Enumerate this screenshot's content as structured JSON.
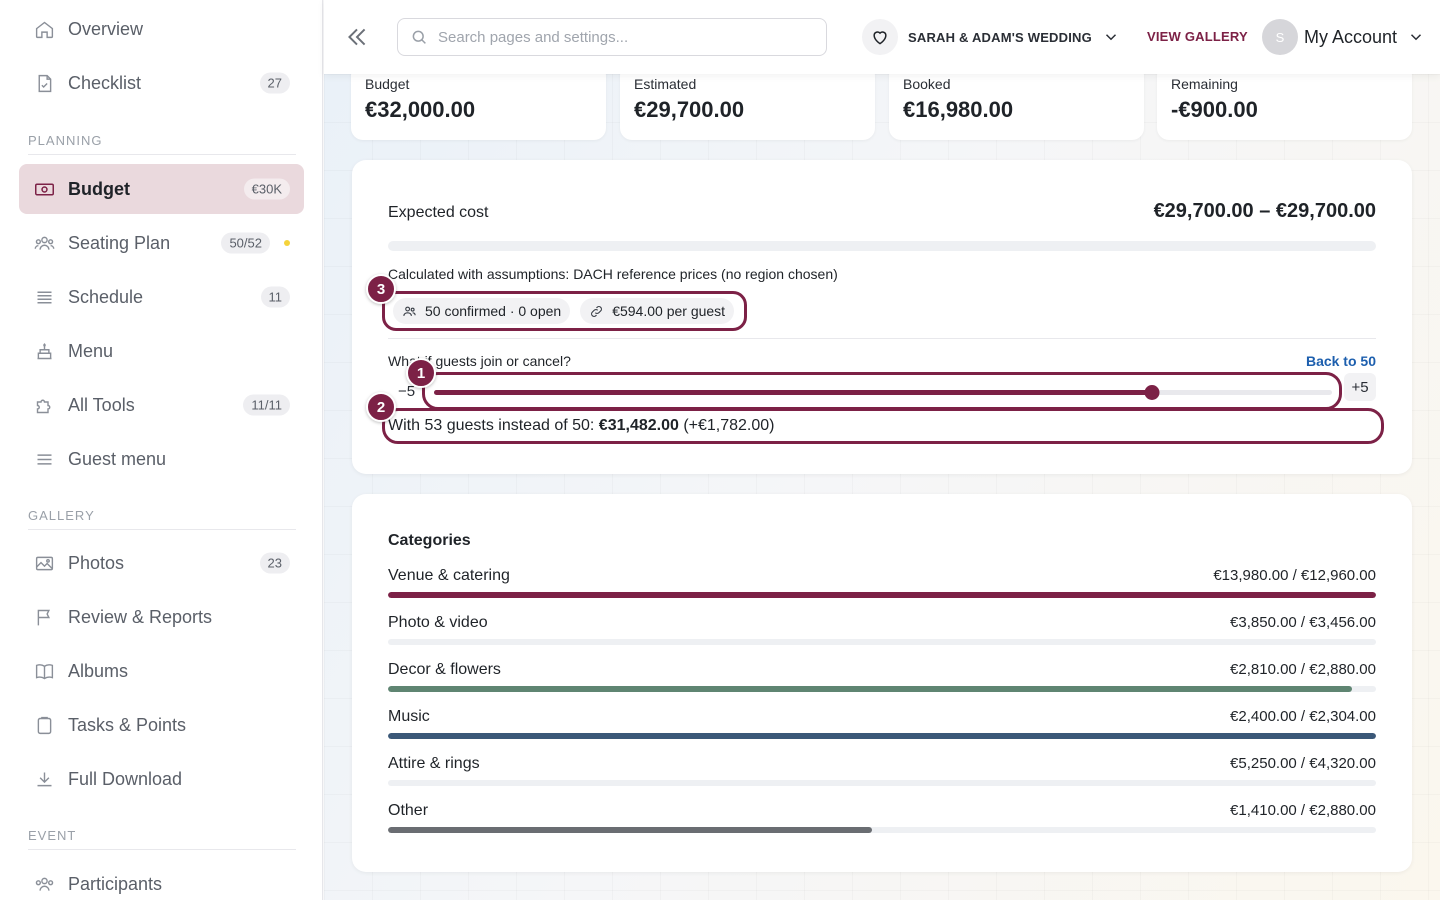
{
  "sidebar": {
    "items": [
      {
        "label": "Overview",
        "icon": "home-icon",
        "badge": ""
      },
      {
        "label": "Checklist",
        "icon": "checklist-icon",
        "badge": "27"
      },
      {
        "label": "Budget",
        "icon": "money-icon",
        "badge": "€30K",
        "active": true
      },
      {
        "label": "Seating Plan",
        "icon": "people-icon",
        "badge": "50/52",
        "dot": true
      },
      {
        "label": "Schedule",
        "icon": "list-icon",
        "badge": "11"
      },
      {
        "label": "Menu",
        "icon": "cake-icon",
        "badge": ""
      },
      {
        "label": "All Tools",
        "icon": "puzzle-icon",
        "badge": "11/11"
      },
      {
        "label": "Guest menu",
        "icon": "menu-icon",
        "badge": ""
      },
      {
        "label": "Photos",
        "icon": "image-icon",
        "badge": "23"
      },
      {
        "label": "Review & Reports",
        "icon": "flag-icon",
        "badge": ""
      },
      {
        "label": "Albums",
        "icon": "book-icon",
        "badge": ""
      },
      {
        "label": "Tasks & Points",
        "icon": "clipboard-icon",
        "badge": ""
      },
      {
        "label": "Full Download",
        "icon": "download-icon",
        "badge": ""
      },
      {
        "label": "Participants",
        "icon": "people-icon",
        "badge": ""
      }
    ],
    "sections": {
      "planning": "PLANNING",
      "gallery": "GALLERY",
      "event": "EVENT"
    }
  },
  "topbar": {
    "search_placeholder": "Search pages and settings...",
    "wedding_name": "SARAH & ADAM'S WEDDING",
    "gallery_link": "VIEW GALLERY",
    "avatar_initial": "S",
    "account_label": "My Account"
  },
  "stats": [
    {
      "label": "Budget",
      "value": "€32,000.00"
    },
    {
      "label": "Estimated",
      "value": "€29,700.00"
    },
    {
      "label": "Booked",
      "value": "€16,980.00"
    },
    {
      "label": "Remaining",
      "value": "-€900.00"
    }
  ],
  "expected": {
    "label": "Expected cost",
    "range": "€29,700.00 – €29,700.00",
    "assumptions": "Calculated with assumptions: DACH reference prices (no region chosen)",
    "chip_guests": "50 confirmed · 0 open",
    "chip_per_guest": "€594.00 per guest"
  },
  "whatif": {
    "question": "What if guests join or cancel?",
    "back_link": "Back to 50",
    "min_label": "−5",
    "max_label": "+5",
    "slider_fraction": 0.8,
    "result_prefix": "With 53 guests instead of 50: ",
    "result_amount": "€31,482.00",
    "result_delta": " (+€1,782.00)"
  },
  "steps": [
    "1",
    "2",
    "3"
  ],
  "categories": {
    "title": "Categories",
    "rows": [
      {
        "name": "Venue & catering",
        "amount": "€13,980.00 / €12,960.00",
        "fraction": 1.0,
        "color": "#7c2146"
      },
      {
        "name": "Photo & video",
        "amount": "€3,850.00 / €3,456.00",
        "fraction": 0.0,
        "color": "#7c2146"
      },
      {
        "name": "Decor & flowers",
        "amount": "€2,810.00 / €2,880.00",
        "fraction": 0.976,
        "color": "#5f8572"
      },
      {
        "name": "Music",
        "amount": "€2,400.00 / €2,304.00",
        "fraction": 1.0,
        "color": "#3b5878"
      },
      {
        "name": "Attire & rings",
        "amount": "€5,250.00 / €4,320.00",
        "fraction": 0.0,
        "color": "#7c2146"
      },
      {
        "name": "Other",
        "amount": "€1,410.00 / €2,880.00",
        "fraction": 0.49,
        "color": "#6a6d72"
      }
    ]
  },
  "colors": {
    "accent": "#7c2146",
    "link": "#1d5fae",
    "active_bg": "#ead9dd"
  }
}
